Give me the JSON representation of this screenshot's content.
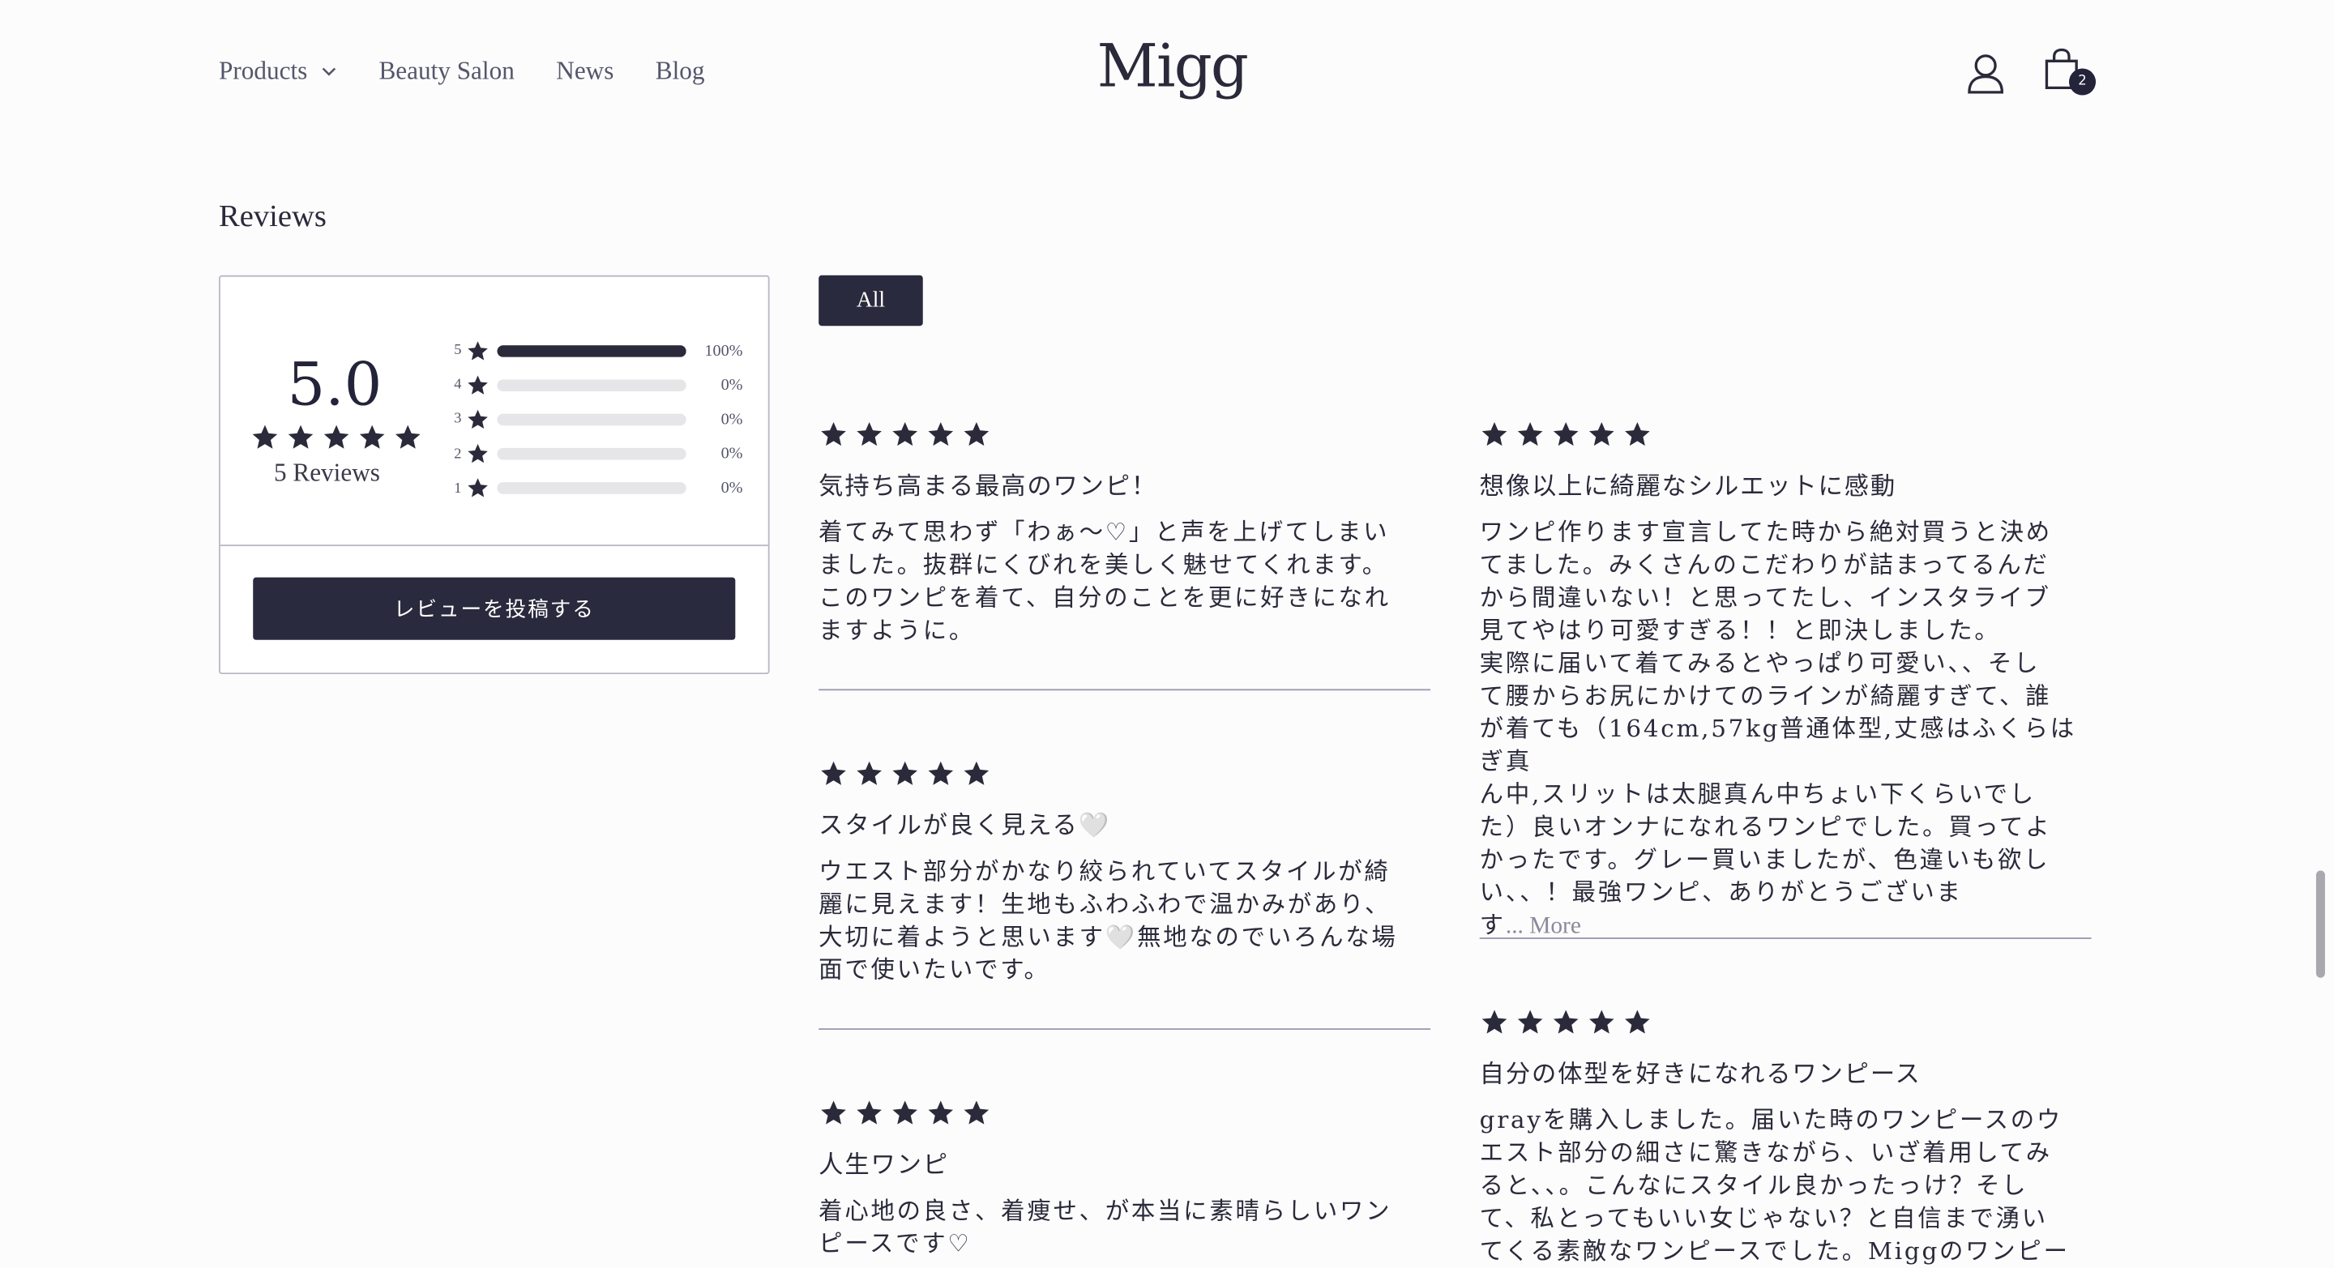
{
  "header": {
    "nav": [
      {
        "label": "Products",
        "has_dropdown": true
      },
      {
        "label": "Beauty Salon"
      },
      {
        "label": "News"
      },
      {
        "label": "Blog"
      }
    ],
    "logo": "Migg",
    "cart_count": "2",
    "icons": {
      "account": "user-icon",
      "cart": "shopping-bag-icon"
    }
  },
  "reviews": {
    "heading": "Reviews",
    "summary": {
      "average": "5.0",
      "rating": 5,
      "count_label": "5 Reviews",
      "distribution": [
        {
          "stars": "5",
          "fraction": 1.0,
          "pct": "100%"
        },
        {
          "stars": "4",
          "fraction": 0,
          "pct": "0%"
        },
        {
          "stars": "3",
          "fraction": 0,
          "pct": "0%"
        },
        {
          "stars": "2",
          "fraction": 0,
          "pct": "0%"
        },
        {
          "stars": "1",
          "fraction": 0,
          "pct": "0%"
        }
      ],
      "write_button": "レビューを投稿する"
    },
    "filter": {
      "all_label": "All"
    },
    "items": [
      {
        "rating": 5,
        "title": "気持ち高まる最高のワンピ！",
        "body": "着てみて思わず「わぁ〜♡」と声を上げてしまい\nました。抜群にくびれを美しく魅せてくれます。\nこのワンピを着て、自分のことを更に好きになれ\nますように。"
      },
      {
        "rating": 5,
        "title": "想像以上に綺麗なシルエットに感動",
        "body": "ワンピ作ります宣言してた時から絶対買うと決め\nてました。みくさんのこだわりが詰まってるんだ\nから間違いない！と思ってたし、インスタライブ\n見てやはり可愛すぎる！！と即決しました。\n実際に届いて着てみるとやっぱり可愛い、、そし\nて腰からお尻にかけてのラインが綺麗すぎて、誰\nが着ても（164cm,57kg普通体型,丈感はふくらはぎ真\nん中,スリットは太腿真ん中ちょい下くらいでし\nた）良いオンナになれるワンピでした。買ってよ\nかったです。グレー買いましたが、色違いも欲し\nい、、！最強ワンピ、ありがとうございま\nす",
        "more": "... More"
      },
      {
        "rating": 5,
        "title": "スタイルが良く見える🤍",
        "body": "ウエスト部分がかなり絞られていてスタイルが綺\n麗に見えます！生地もふわふわで温かみがあり、\n大切に着ようと思います🤍無地なのでいろんな場\n面で使いたいです。"
      },
      {
        "rating": 5,
        "title": "自分の体型を好きになれるワンピース",
        "body": "grayを購入しました。届いた時のワンピースのウ\nエスト部分の細さに驚きながら、いざ着用してみ\nると、、。こんなにスタイル良かったっけ？そし\nて、私とってもいい女じゃない？と自信まで湧い\nてくる素敵なワンピースでした。Miggのワンピー"
      },
      {
        "rating": 5,
        "title": "人生ワンピ",
        "body": "着心地の良さ、着痩せ、が本当に素晴らしいワン\nピースです♡"
      }
    ]
  },
  "colors": {
    "primary": "#2a2a3e",
    "text": "#2a2a3a",
    "muted": "#55566a",
    "bar_bg": "#e6e6e9"
  }
}
